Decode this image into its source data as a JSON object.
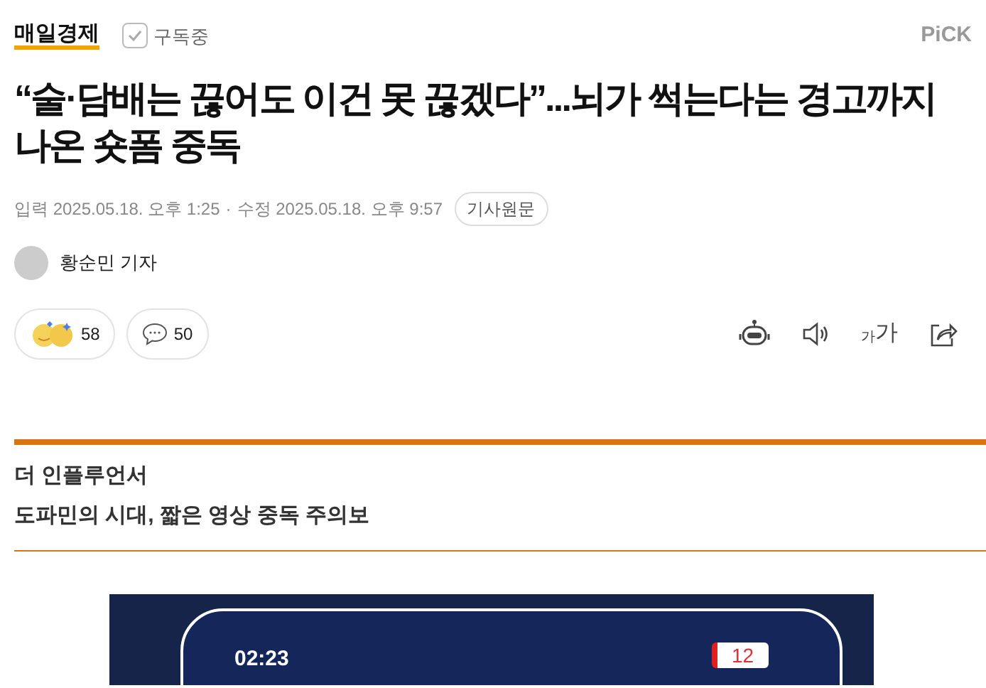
{
  "header": {
    "press": "매일경제",
    "subscribe": {
      "label": "구독중",
      "checked": true
    },
    "pick": "PiCK"
  },
  "headline": "“술·담배는 끊어도 이건 못 끊겠다”...뇌가 썩는다는 경고까지 나온 숏폼 중독",
  "meta": {
    "published": "입력 2025.05.18. 오후 1:25",
    "separator": "·",
    "modified": "수정 2025.05.18. 오후 9:57",
    "original_button": "기사원문"
  },
  "reporter": "황순민 기자",
  "reactions": [
    {
      "kind": "emotion",
      "count": "58"
    },
    {
      "kind": "comment",
      "count": "50"
    }
  ],
  "tools": [
    {
      "kind": "robot"
    },
    {
      "kind": "speaker"
    },
    {
      "kind": "font",
      "small": "가",
      "large": "가"
    },
    {
      "kind": "share"
    }
  ],
  "series": {
    "title": "더 인플루언서",
    "subtitle": "도파민의 시대, 짧은 영상 중독 주의보"
  },
  "illustration": {
    "time": "02:23",
    "battery": "12"
  }
}
